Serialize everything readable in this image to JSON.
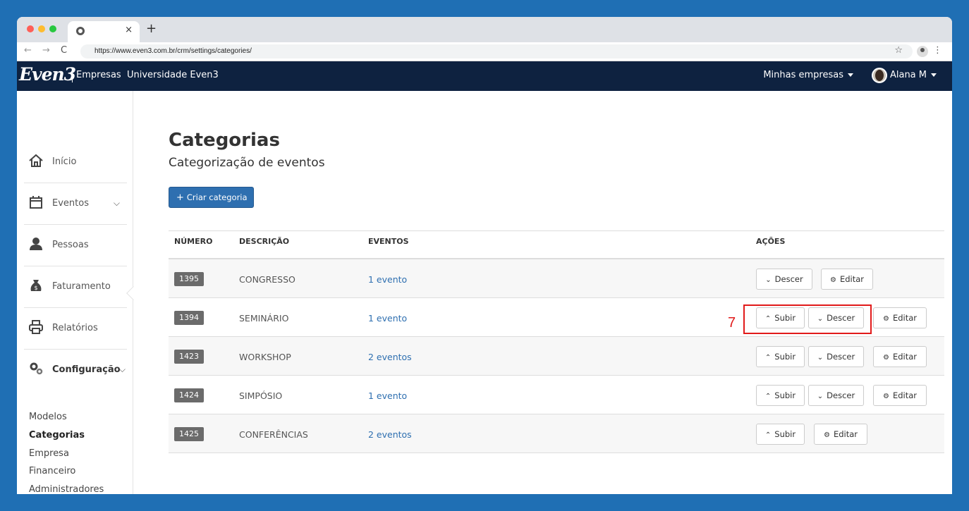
{
  "browser": {
    "url": "https://www.even3.com.br/crm/settings/categories/",
    "tab_close": "×",
    "new_tab": "+",
    "back": "←",
    "forward": "→",
    "reload": "C",
    "star": "☆",
    "menu": "⋮"
  },
  "header": {
    "logo": "Even3",
    "empresas": "Empresas",
    "universidade": "Universidade Even3",
    "minhas_empresas": "Minhas empresas",
    "user": "Alana M"
  },
  "sidebar": {
    "items": [
      {
        "label": "Início",
        "icon": "home-icon"
      },
      {
        "label": "Eventos",
        "icon": "calendar-icon"
      },
      {
        "label": "Pessoas",
        "icon": "person-icon"
      },
      {
        "label": "Faturamento",
        "icon": "money-bag-icon"
      },
      {
        "label": "Relatórios",
        "icon": "printer-icon"
      },
      {
        "label": "Configuração",
        "icon": "gears-icon"
      }
    ],
    "sub_items": [
      "Modelos",
      "Categorias",
      "Empresa",
      "Financeiro",
      "Administradores"
    ],
    "active_sub": "Categorias",
    "chevron": "⌵"
  },
  "main": {
    "title": "Categorias",
    "subtitle": "Categorização de eventos",
    "create_button": "Criar categoria",
    "create_plus": "+"
  },
  "table": {
    "headers": [
      "NÚMERO",
      "DESCRIÇÃO",
      "EVENTOS",
      "AÇÕES"
    ],
    "rows": [
      {
        "number": "1395",
        "description": "CONGRESSO",
        "events": "1 evento",
        "actions": [
          "Descer",
          "Editar"
        ]
      },
      {
        "number": "1394",
        "description": "SEMINÁRIO",
        "events": "1 evento",
        "actions": [
          "Subir",
          "Descer",
          "Editar"
        ]
      },
      {
        "number": "1423",
        "description": "WORKSHOP",
        "events": "2 eventos",
        "actions": [
          "Subir",
          "Descer",
          "Editar"
        ]
      },
      {
        "number": "1424",
        "description": "SIMPÓSIO",
        "events": "1 evento",
        "actions": [
          "Subir",
          "Descer",
          "Editar"
        ]
      },
      {
        "number": "1425",
        "description": "CONFERÊNCIAS",
        "events": "2 eventos",
        "actions": [
          "Subir",
          "Editar"
        ]
      }
    ],
    "glyphs": {
      "up": "⌃",
      "down": "⌄",
      "gears": "⚙"
    }
  },
  "annotation": {
    "step": "7",
    "color": "#e11a1a"
  },
  "colors": {
    "background": "#1f6fb4",
    "header": "#0e2240",
    "primary": "#2e6fb0",
    "badge": "#6b6b6b"
  }
}
